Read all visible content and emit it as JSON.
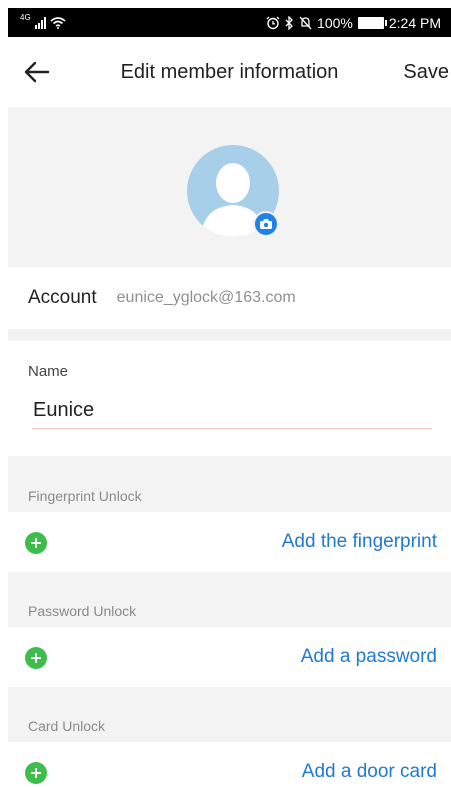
{
  "status_bar": {
    "network": "4G",
    "battery": "100%",
    "time": "2:24 PM"
  },
  "header": {
    "title": "Edit member information",
    "save_label": "Save"
  },
  "account": {
    "label": "Account",
    "value": "eunice_yglock@163.com"
  },
  "name_field": {
    "label": "Name",
    "value": "Eunice"
  },
  "unlock_sections": {
    "fingerprint": {
      "title": "Fingerprint Unlock",
      "action": "Add the fingerprint"
    },
    "password": {
      "title": "Password Unlock",
      "action": "Add a password"
    },
    "card": {
      "title": "Card Unlock",
      "action": "Add a door card"
    }
  },
  "colors": {
    "accent_blue": "#1f7ad6",
    "add_green": "#3dbd4c",
    "avatar_bg": "#a7cfe9",
    "section_bg": "#f3f3f3"
  }
}
